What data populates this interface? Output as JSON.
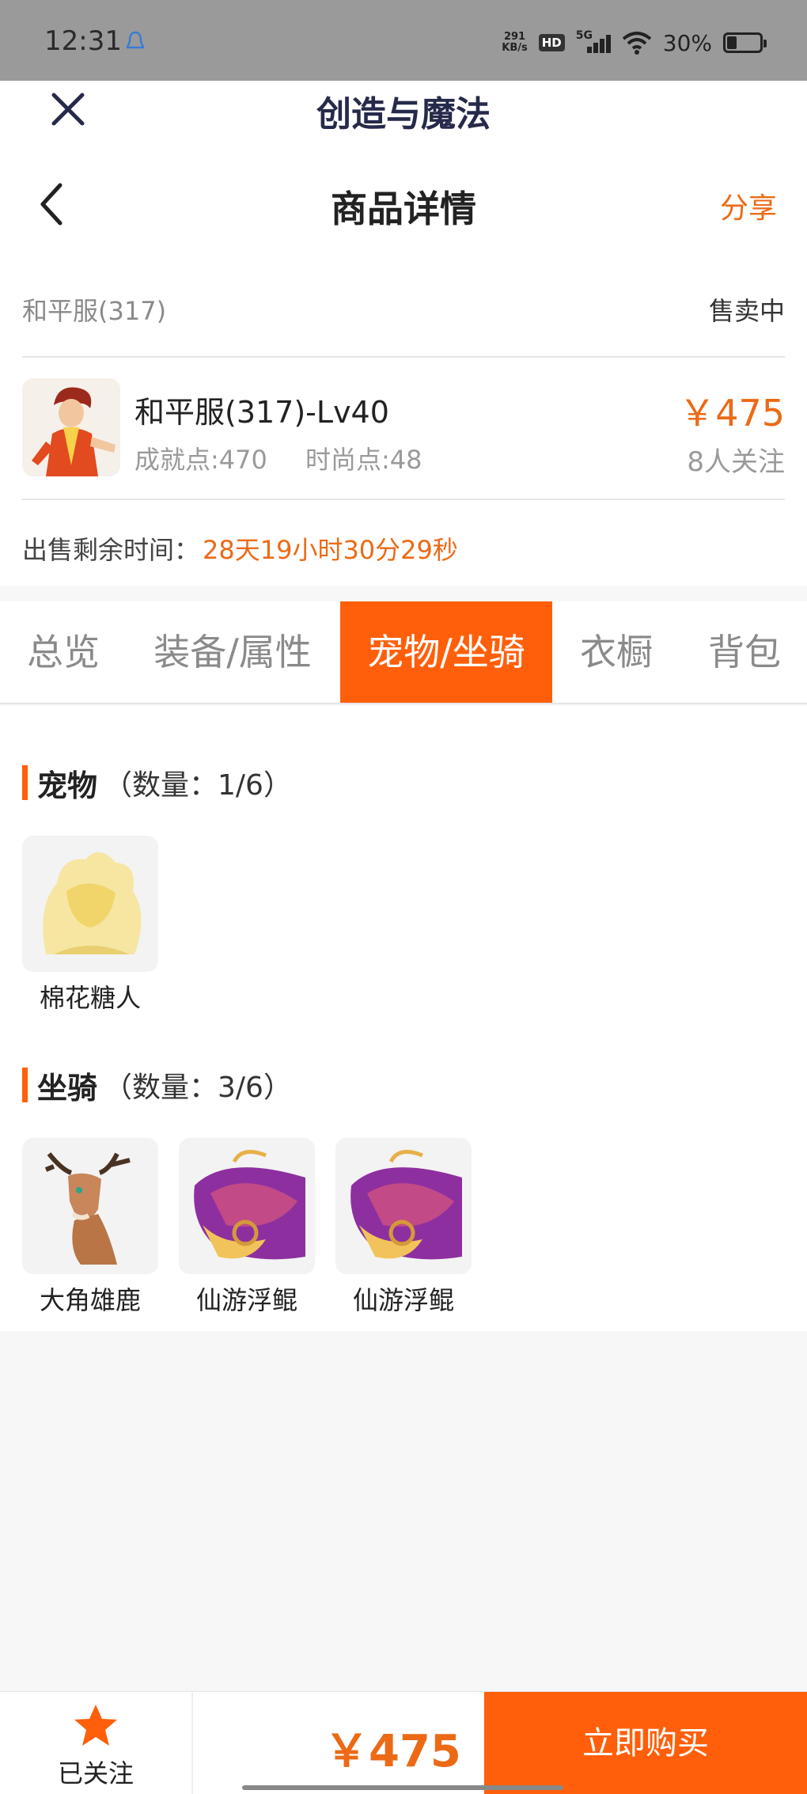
{
  "status_bar": {
    "time": "12:31",
    "net_speed_value": "291",
    "net_speed_unit": "KB/s",
    "hd_badge": "HD",
    "network": "5G",
    "battery": "30%",
    "battery_level": 0.3
  },
  "app": {
    "title": "创造与魔法"
  },
  "header": {
    "title": "商品详情",
    "share_label": "分享"
  },
  "product": {
    "server": "和平服(317)",
    "status": "售卖中",
    "role_name": "和平服(317)-Lv40",
    "achievement": "成就点:470",
    "fashion": "时尚点:48",
    "price": "￥475",
    "followers": "8人关注",
    "remain_label": "出售剩余时间：",
    "remain_time": "28天19小时30分29秒"
  },
  "tabs": [
    {
      "label": "总览"
    },
    {
      "label": "装备/属性"
    },
    {
      "label": "宠物/坐骑"
    },
    {
      "label": "衣橱"
    },
    {
      "label": "背包"
    }
  ],
  "active_tab": "宠物/坐骑",
  "pets": {
    "title": "宠物",
    "count": "（数量：1/6）",
    "items": [
      {
        "name": "棉花糖人"
      }
    ]
  },
  "mounts": {
    "title": "坐骑",
    "count": "（数量：3/6）",
    "items": [
      {
        "name": "大角雄鹿"
      },
      {
        "name": "仙游浮鲲"
      },
      {
        "name": "仙游浮鲲"
      }
    ]
  },
  "bottom_bar": {
    "follow_label": "已关注",
    "price": "￥475",
    "buy_label": "立即购买"
  },
  "colors": {
    "accent": "#ff5f0a",
    "price": "#ec6a16",
    "status_bar": "#9a9a9a"
  }
}
